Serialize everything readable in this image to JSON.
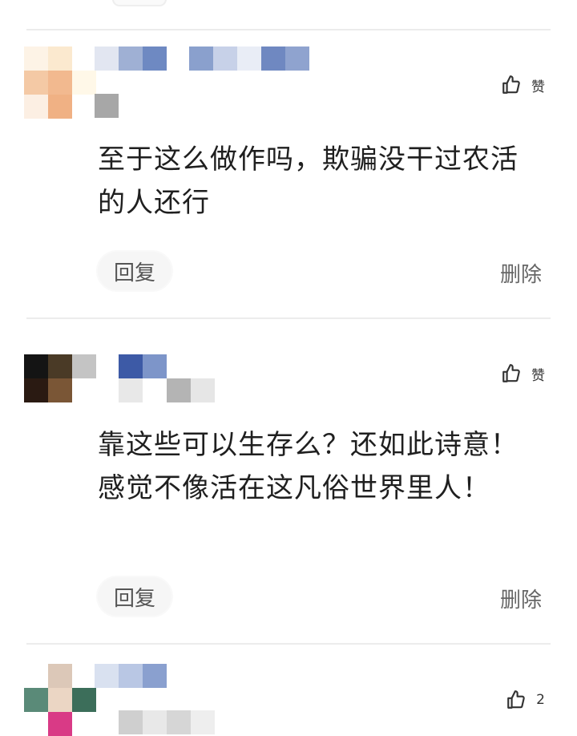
{
  "colors": {
    "text_primary": "#1f1f1f",
    "text_secondary": "#666666",
    "divider": "#ececec",
    "reply_bg": "#f6f6f6"
  },
  "comments": [
    {
      "like_label": "赞",
      "like_icon": "thumbs-up-icon",
      "content": "至于这么做作吗，欺骗没干过农活的人还行",
      "reply_label": "回复",
      "delete_label": "删除"
    },
    {
      "like_label": "赞",
      "like_icon": "thumbs-up-icon",
      "content": "靠这些可以生存么？还如此诗意！感觉不像活在这凡俗世界里人！",
      "reply_label": "回复",
      "delete_label": "删除"
    },
    {
      "like_label": "2",
      "like_icon": "thumbs-up-icon"
    }
  ]
}
